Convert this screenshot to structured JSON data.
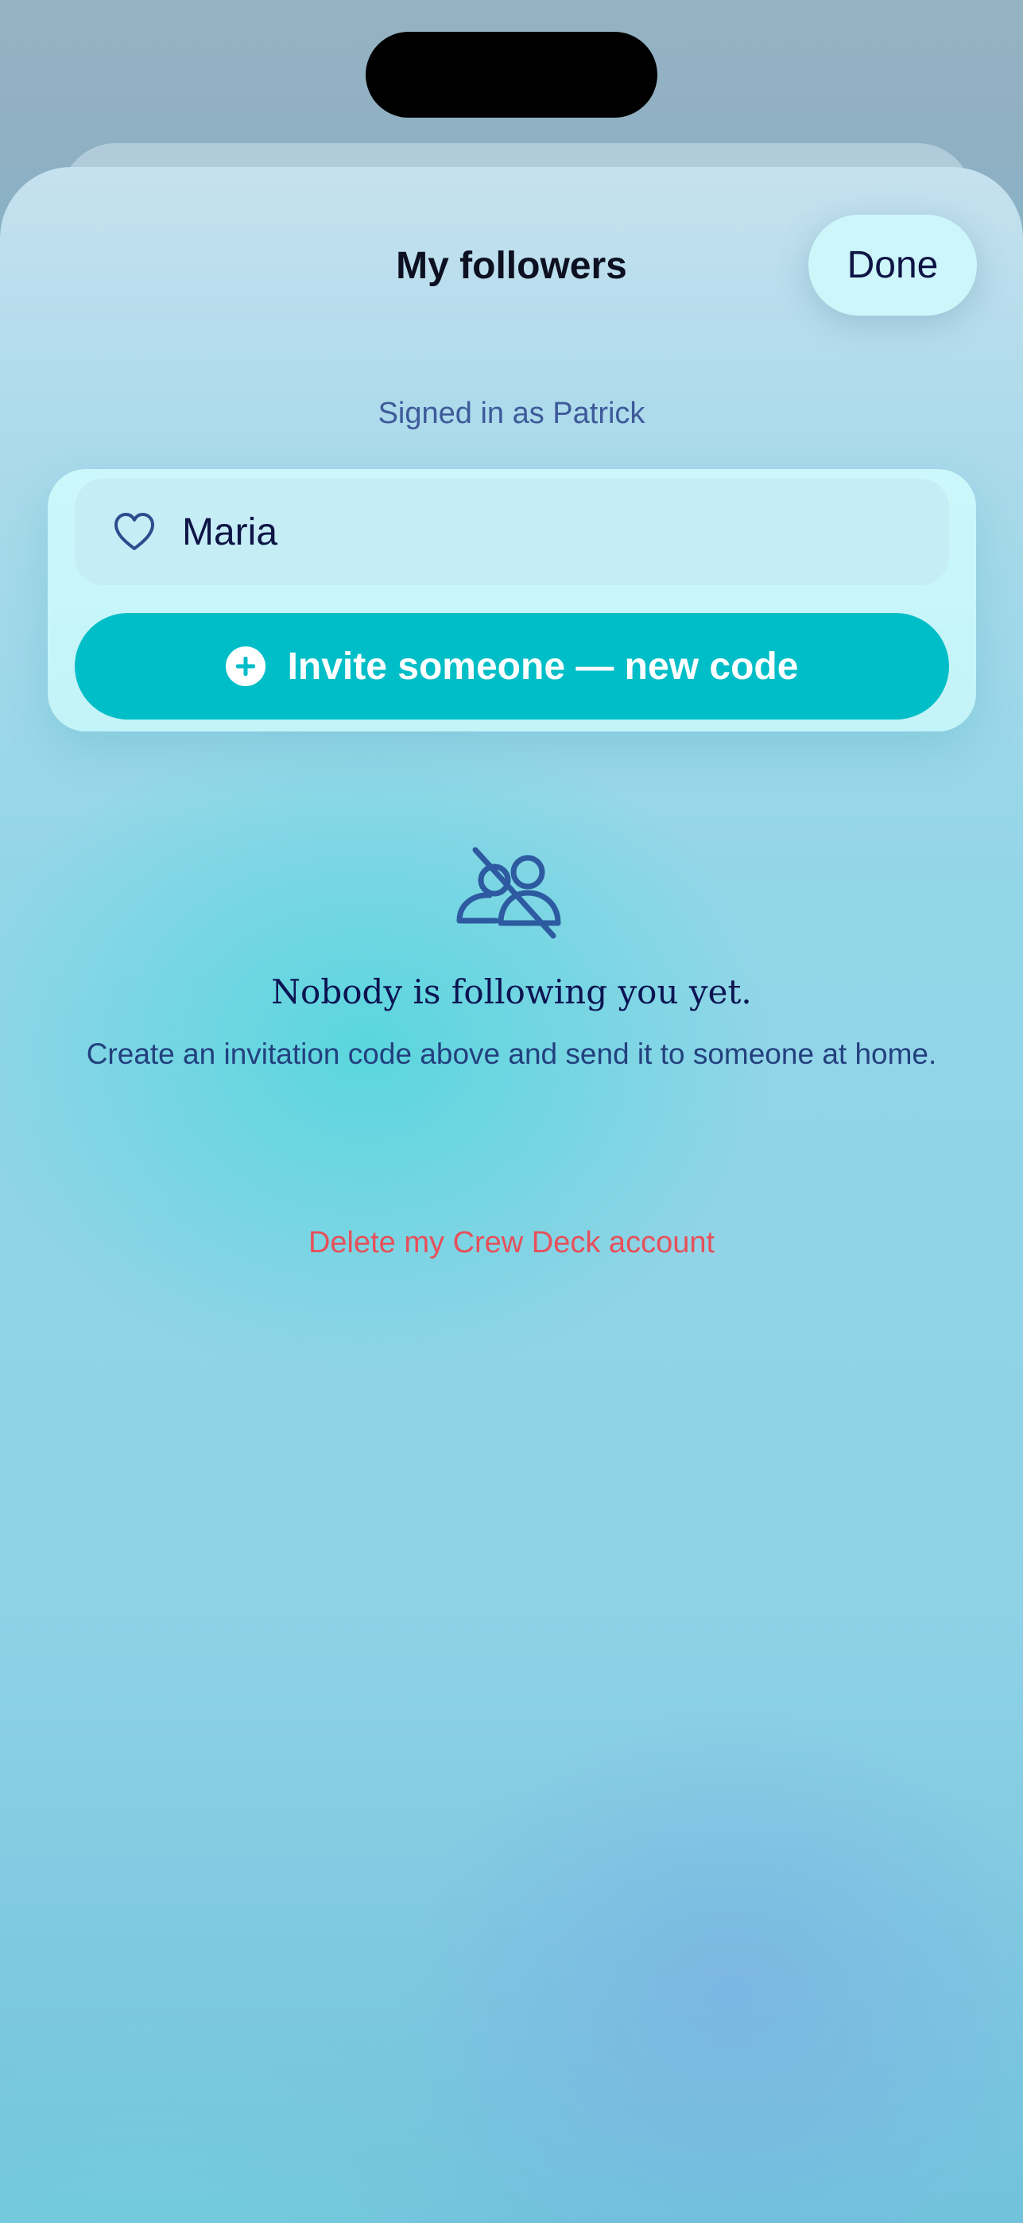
{
  "header": {
    "title": "My followers",
    "done_label": "Done"
  },
  "account": {
    "signed_in_text": "Signed in as Patrick"
  },
  "followers": {
    "items": [
      {
        "name": "Maria",
        "icon": "heart-icon"
      }
    ],
    "invite_label": "Invite someone — new code",
    "invite_icon": "plus-circle-icon"
  },
  "empty_state": {
    "icon": "people-slash-icon",
    "title": "Nobody is following you yet.",
    "description": "Create an invitation code above and send it to someone at home."
  },
  "footer": {
    "delete_label": "Delete my Crew Deck account"
  },
  "colors": {
    "accent": "#00bec7",
    "destructive": "#e6505a",
    "text_primary": "#0e1445",
    "text_secondary": "#3e5a9a"
  }
}
